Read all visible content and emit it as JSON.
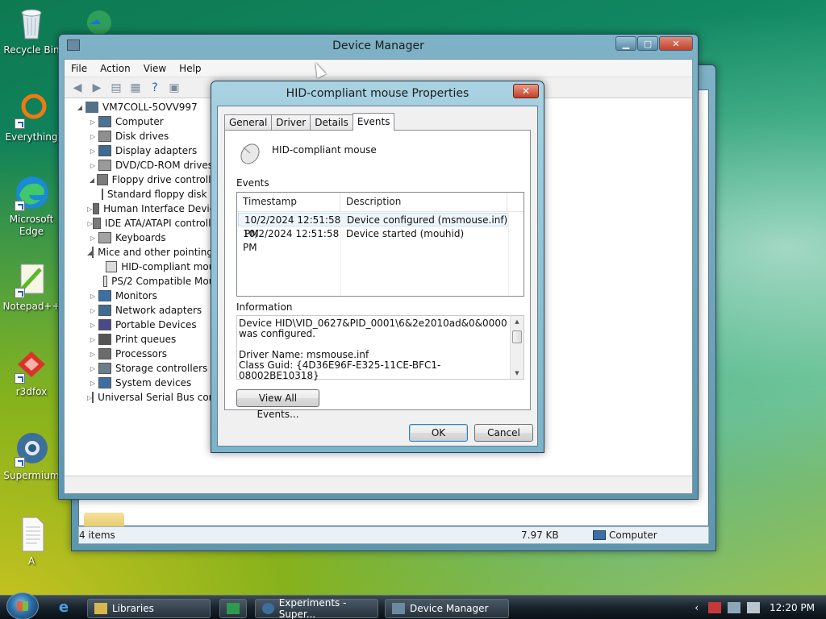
{
  "desktop": {
    "icons": [
      {
        "name": "recycle-bin-icon",
        "label": "Recycle Bin"
      },
      {
        "name": "everything-icon",
        "label": "Everything"
      },
      {
        "name": "edge-icon",
        "label": "Microsoft Edge"
      },
      {
        "name": "notepadpp-icon",
        "label": "Notepad++"
      },
      {
        "name": "r3dfox-icon",
        "label": "r3dfox"
      },
      {
        "name": "supermium-icon",
        "label": "Supermium"
      },
      {
        "name": "text-file-icon",
        "label": "A"
      }
    ]
  },
  "explorer": {
    "status_items": "4 items",
    "status_size": "7.97 KB",
    "status_location": "Computer"
  },
  "device_manager": {
    "title": "Device Manager",
    "menu": [
      "File",
      "Action",
      "View",
      "Help"
    ],
    "tree": {
      "root": "VM7COLL-5OVV997",
      "items": [
        {
          "label": "Computer",
          "level": 1,
          "expander": "▷"
        },
        {
          "label": "Disk drives",
          "level": 1,
          "expander": "▷"
        },
        {
          "label": "Display adapters",
          "level": 1,
          "expander": "▷"
        },
        {
          "label": "DVD/CD-ROM drives",
          "level": 1,
          "expander": "▷"
        },
        {
          "label": "Floppy drive controllers",
          "level": 1,
          "expander": "◢"
        },
        {
          "label": "Standard floppy disk controller",
          "level": 2,
          "expander": ""
        },
        {
          "label": "Human Interface Devices",
          "level": 1,
          "expander": "▷"
        },
        {
          "label": "IDE ATA/ATAPI controllers",
          "level": 1,
          "expander": "▷"
        },
        {
          "label": "Keyboards",
          "level": 1,
          "expander": "▷"
        },
        {
          "label": "Mice and other pointing devices",
          "level": 1,
          "expander": "◢"
        },
        {
          "label": "HID-compliant mouse",
          "level": 2,
          "expander": ""
        },
        {
          "label": "PS/2 Compatible Mouse",
          "level": 2,
          "expander": ""
        },
        {
          "label": "Monitors",
          "level": 1,
          "expander": "▷"
        },
        {
          "label": "Network adapters",
          "level": 1,
          "expander": "▷"
        },
        {
          "label": "Portable Devices",
          "level": 1,
          "expander": "▷"
        },
        {
          "label": "Print queues",
          "level": 1,
          "expander": "▷"
        },
        {
          "label": "Processors",
          "level": 1,
          "expander": "▷"
        },
        {
          "label": "Storage controllers",
          "level": 1,
          "expander": "▷"
        },
        {
          "label": "System devices",
          "level": 1,
          "expander": "▷"
        },
        {
          "label": "Universal Serial Bus controllers",
          "level": 1,
          "expander": "▷"
        }
      ]
    }
  },
  "properties": {
    "title": "HID-compliant mouse Properties",
    "tabs": [
      "General",
      "Driver",
      "Details",
      "Events"
    ],
    "active_tab": "Events",
    "device_name": "HID-compliant mouse",
    "events_label": "Events",
    "columns": [
      "Timestamp",
      "Description"
    ],
    "events": [
      {
        "timestamp": "10/2/2024 12:51:58 PM",
        "description": "Device configured (msmouse.inf)"
      },
      {
        "timestamp": "10/2/2024 12:51:58 PM",
        "description": "Device started (mouhid)"
      }
    ],
    "information_label": "Information",
    "information_lines": [
      "Device HID\\VID_0627&PID_0001\\6&2e2010ad&0&0000 was configured.",
      "",
      "Driver Name: msmouse.inf",
      "Class Guid: {4D36E96F-E325-11CE-BFC1-08002BE10318}"
    ],
    "view_all_button": "View All Events...",
    "ok_button": "OK",
    "cancel_button": "Cancel"
  },
  "taskbar": {
    "items": [
      {
        "label": "Libraries"
      },
      {
        "label": "Experiments - Super..."
      },
      {
        "label": "Device Manager"
      }
    ],
    "clock": "12:20 PM"
  }
}
